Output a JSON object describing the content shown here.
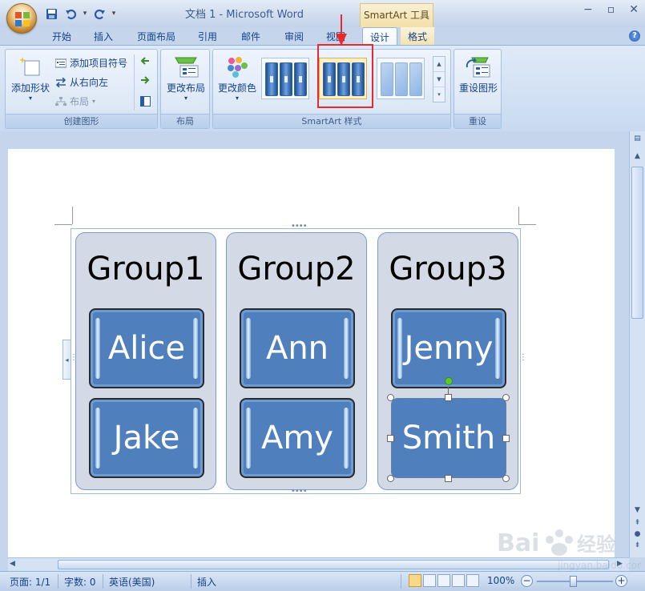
{
  "window": {
    "title": "文档 1 - Microsoft Word",
    "contextual_tools": "SmartArt 工具",
    "controls": [
      "minimize-icon",
      "maximize-icon",
      "close-icon"
    ]
  },
  "qat": {
    "icons": [
      "save-icon",
      "undo-icon",
      "redo-icon",
      "customize-qat-icon"
    ]
  },
  "tabs": [
    {
      "label": "开始"
    },
    {
      "label": "插入"
    },
    {
      "label": "页面布局"
    },
    {
      "label": "引用"
    },
    {
      "label": "邮件"
    },
    {
      "label": "审阅"
    },
    {
      "label": "视图"
    },
    {
      "label": "设计",
      "active": true
    },
    {
      "label": "格式"
    }
  ],
  "ribbon": {
    "create_graphic": {
      "label": "创建图形",
      "add_shape": "添加形状",
      "add_bullet": "添加项目符号",
      "right_to_left": "从右向左",
      "layout": "布局"
    },
    "layouts": {
      "label": "布局",
      "change_layout": "更改布局"
    },
    "styles": {
      "label": "SmartArt 样式",
      "change_colors": "更改颜色"
    },
    "reset": {
      "label": "重设",
      "reset_graphic": "重设图形"
    }
  },
  "smartart": {
    "groups": [
      {
        "title": "Group1",
        "items": [
          "Alice",
          "Jake"
        ]
      },
      {
        "title": "Group2",
        "items": [
          "Ann",
          "Amy"
        ]
      },
      {
        "title": "Group3",
        "items": [
          "Jenny",
          "Smith"
        ]
      }
    ],
    "selected_item": "Smith"
  },
  "status": {
    "page": "页面: 1/1",
    "words": "字数: 0",
    "language": "英语(美国)",
    "mode": "插入",
    "zoom": "100%"
  },
  "colors": {
    "accent_blue": "#4f80bd",
    "highlight_red": "#ea2a2a"
  }
}
